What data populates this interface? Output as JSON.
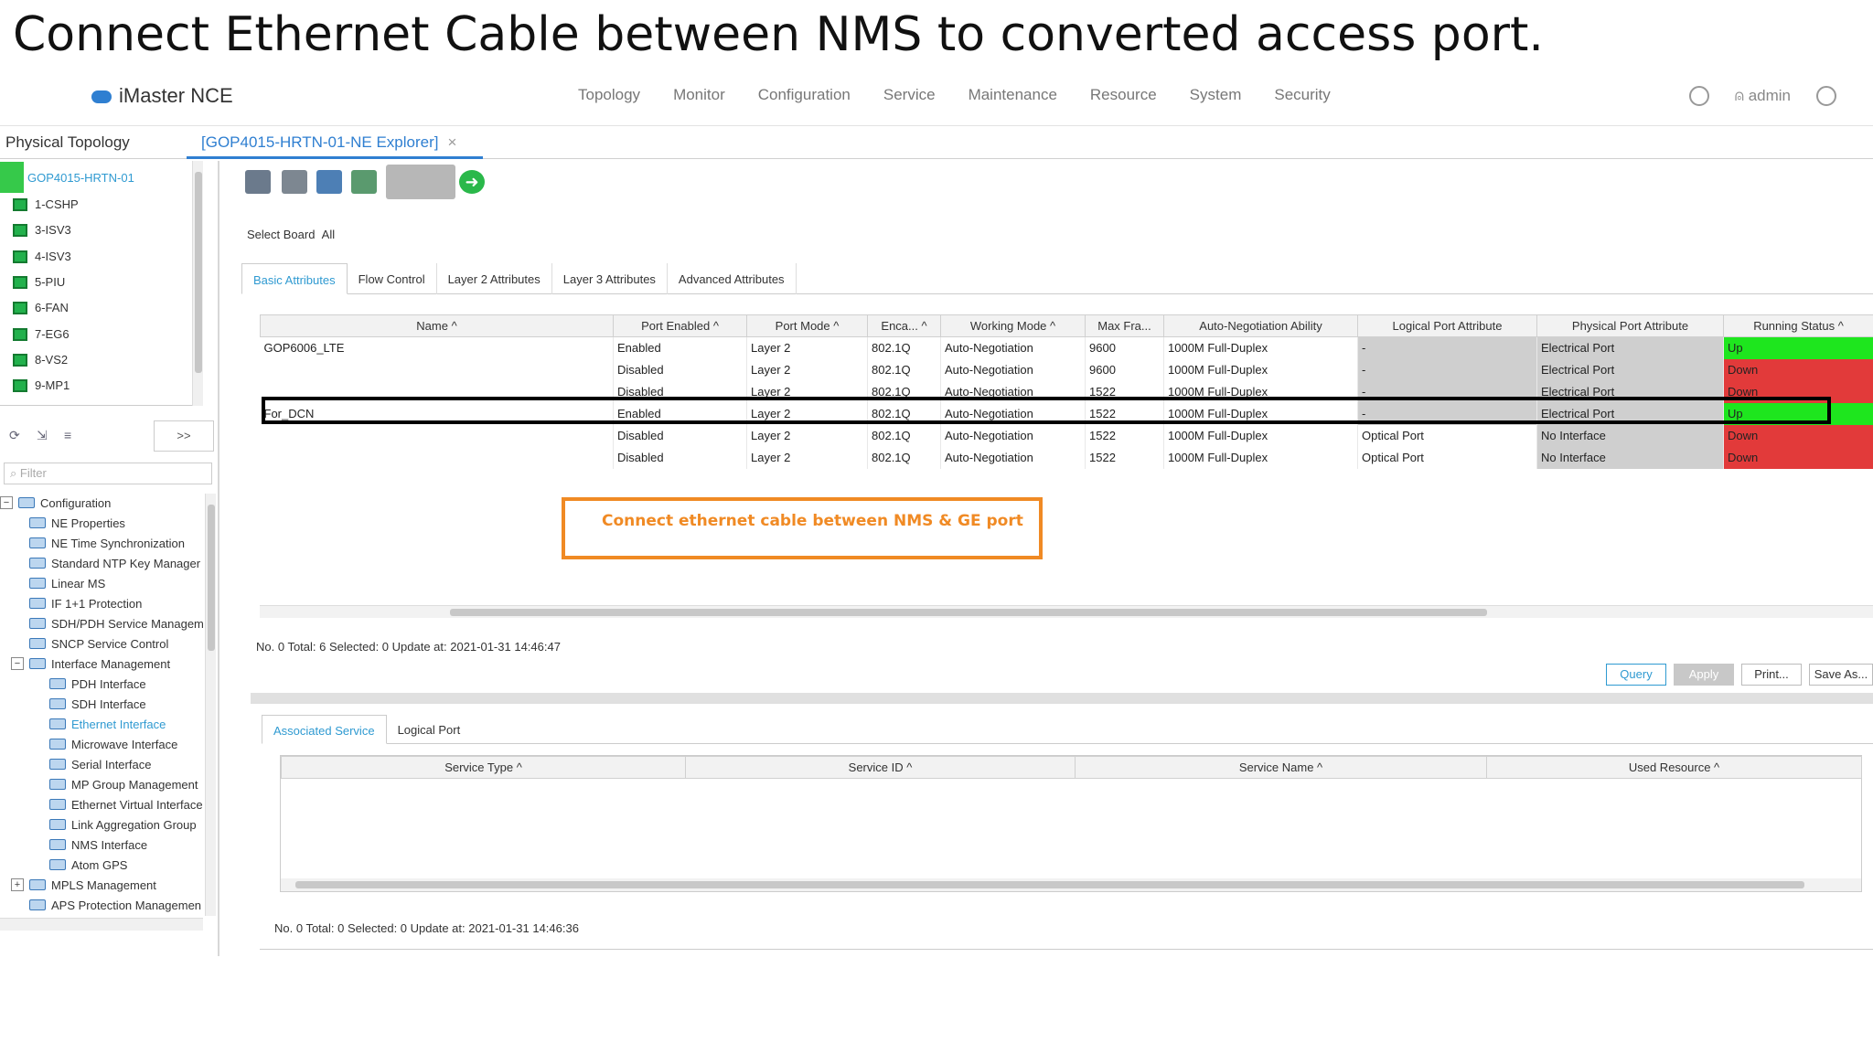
{
  "slide_title": "Connect Ethernet Cable between NMS to converted access port.",
  "app": {
    "logo_text": "iMaster NCE",
    "user": "admin"
  },
  "menu": [
    "Topology",
    "Monitor",
    "Configuration",
    "Service",
    "Maintenance",
    "Resource",
    "System",
    "Security"
  ],
  "tabs": {
    "physical_topology": "Physical Topology",
    "ne_explorer": "[GOP4015-HRTN-01-NE Explorer]",
    "close": "×"
  },
  "left_tree": {
    "root": "GOP4015-HRTN-01",
    "boards": [
      "1-CSHP",
      "3-ISV3",
      "4-ISV3",
      "5-PIU",
      "6-FAN",
      "7-EG6",
      "8-VS2",
      "9-MP1"
    ],
    "expand_label": ">>",
    "filter_placeholder": "Filter",
    "nodes": [
      {
        "label": "Configuration",
        "level": 0,
        "type": "open"
      },
      {
        "label": "NE Properties",
        "level": 1
      },
      {
        "label": "NE Time Synchronization",
        "level": 1
      },
      {
        "label": "Standard NTP Key Manager",
        "level": 1
      },
      {
        "label": "Linear MS",
        "level": 1
      },
      {
        "label": "IF 1+1 Protection",
        "level": 1
      },
      {
        "label": "SDH/PDH Service Managem",
        "level": 1
      },
      {
        "label": "SNCP Service Control",
        "level": 1
      },
      {
        "label": "Interface Management",
        "level": 1,
        "type": "open"
      },
      {
        "label": "PDH Interface",
        "level": 2
      },
      {
        "label": "SDH Interface",
        "level": 2
      },
      {
        "label": "Ethernet Interface",
        "level": 2,
        "selected": true
      },
      {
        "label": "Microwave Interface",
        "level": 2
      },
      {
        "label": "Serial Interface",
        "level": 2
      },
      {
        "label": "MP Group Management",
        "level": 2
      },
      {
        "label": "Ethernet Virtual Interface",
        "level": 2
      },
      {
        "label": "Link Aggregation Group",
        "level": 2
      },
      {
        "label": "NMS Interface",
        "level": 2
      },
      {
        "label": "Atom GPS",
        "level": 2
      },
      {
        "label": "MPLS Management",
        "level": 1,
        "type": "closed"
      },
      {
        "label": "APS Protection Managemen",
        "level": 1
      }
    ]
  },
  "select_board": {
    "label": "Select Board",
    "value": "All"
  },
  "attr_tabs": [
    "Basic Attributes",
    "Flow Control",
    "Layer 2 Attributes",
    "Layer 3 Attributes",
    "Advanced Attributes"
  ],
  "columns": [
    "Name ^",
    "Port Enabled ^",
    "Port Mode ^",
    "Enca... ^",
    "Working Mode ^",
    "Max Fra...",
    "Auto-Negotiation Ability",
    "Logical Port Attribute",
    "Physical Port Attribute",
    "Running Status ^"
  ],
  "rows": [
    [
      "GOP6006_LTE",
      "Enabled",
      "Layer 2",
      "802.1Q",
      "Auto-Negotiation",
      "9600",
      "1000M Full-Duplex",
      "-",
      "Electrical Port",
      "Up"
    ],
    [
      "",
      "Disabled",
      "Layer 2",
      "802.1Q",
      "Auto-Negotiation",
      "9600",
      "1000M Full-Duplex",
      "-",
      "Electrical Port",
      "Down"
    ],
    [
      "",
      "Disabled",
      "Layer 2",
      "802.1Q",
      "Auto-Negotiation",
      "1522",
      "1000M Full-Duplex",
      "-",
      "Electrical Port",
      "Down"
    ],
    [
      "For_DCN",
      "Enabled",
      "Layer 2",
      "802.1Q",
      "Auto-Negotiation",
      "1522",
      "1000M Full-Duplex",
      "-",
      "Electrical Port",
      "Up"
    ],
    [
      "",
      "Disabled",
      "Layer 2",
      "802.1Q",
      "Auto-Negotiation",
      "1522",
      "1000M Full-Duplex",
      "Optical Port",
      "No Interface",
      "Down"
    ],
    [
      "",
      "Disabled",
      "Layer 2",
      "802.1Q",
      "Auto-Negotiation",
      "1522",
      "1000M Full-Duplex",
      "Optical Port",
      "No Interface",
      "Down"
    ]
  ],
  "callout": "Connect ethernet cable between NMS & GE port",
  "status_top": "No. 0  Total: 6  Selected: 0  Update at: 2021-01-31 14:46:47",
  "buttons": {
    "query": "Query",
    "apply": "Apply",
    "print": "Print...",
    "save_as": "Save As..."
  },
  "lower_tabs": [
    "Associated Service",
    "Logical Port"
  ],
  "lower_columns": [
    "Service Type ^",
    "Service ID ^",
    "Service Name ^",
    "Used Resource ^"
  ],
  "status_bottom": "No. 0  Total: 0  Selected: 0  Update at: 2021-01-31 14:46:36",
  "colors": {
    "accent": "#2f9ad1",
    "up": "#1ee61e",
    "down": "#e23a3a",
    "callout": "#f08a24"
  }
}
